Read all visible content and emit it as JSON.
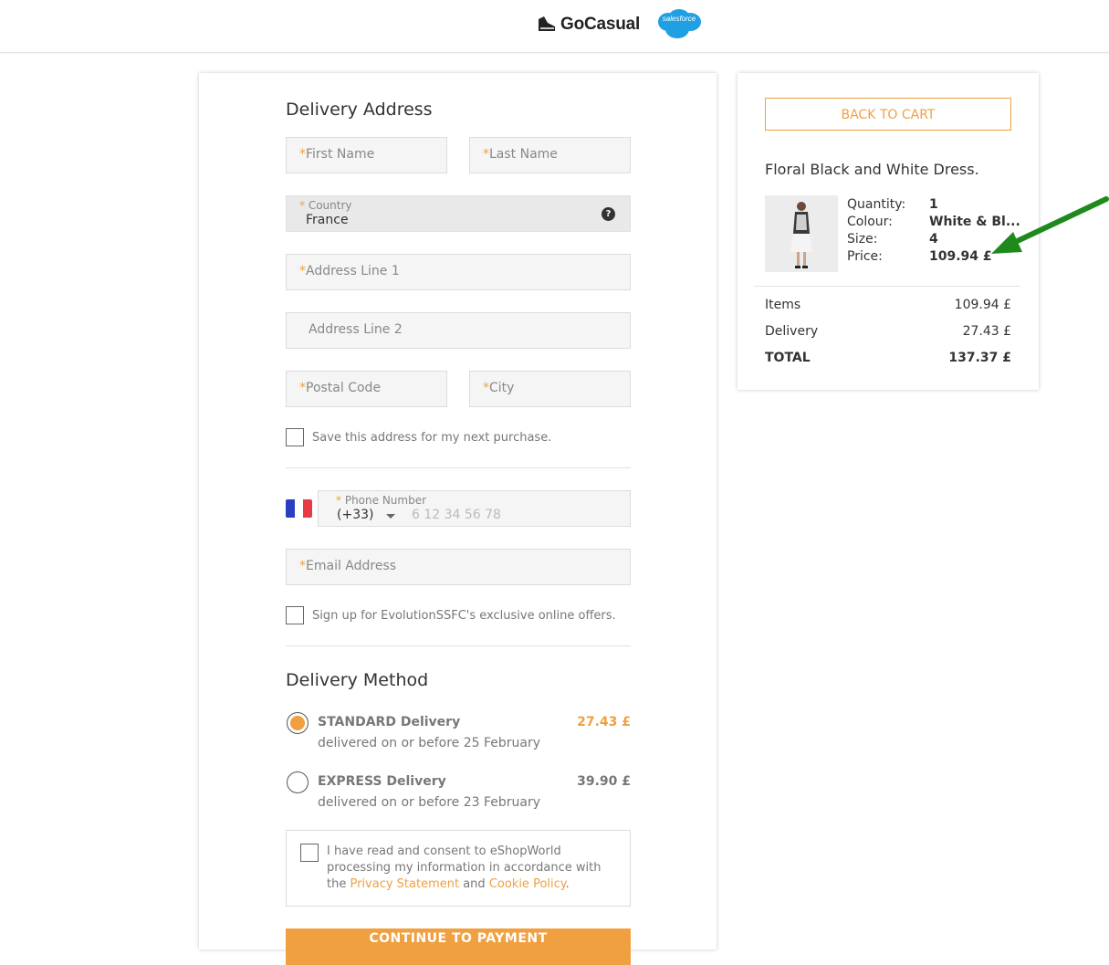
{
  "header": {
    "brand_name": "GoCasual",
    "partner_logo_text": "salesforce"
  },
  "delivery_address": {
    "title": "Delivery Address",
    "first_name_placeholder": "First Name",
    "last_name_placeholder": "Last Name",
    "country_label": "Country",
    "country_value": "France",
    "address_line1_placeholder": "Address Line 1",
    "address_line2_placeholder": "Address Line 2",
    "postal_code_placeholder": "Postal Code",
    "city_placeholder": "City",
    "save_address_label": "Save this address for my next purchase.",
    "phone_label": "Phone Number",
    "phone_prefix": "(+33)",
    "phone_placeholder": "6 12 34 56 78",
    "email_placeholder": "Email Address",
    "signup_label": "Sign up for EvolutionSSFC's exclusive online offers.",
    "required_mark": "*"
  },
  "delivery_method": {
    "title": "Delivery Method",
    "options": [
      {
        "name": "STANDARD Delivery",
        "detail": "delivered on or before 25 February",
        "price": "27.43 £",
        "selected": true
      },
      {
        "name": "EXPRESS Delivery",
        "detail": "delivered on or before 23 February",
        "price": "39.90 £",
        "selected": false
      }
    ]
  },
  "consent": {
    "text_before": "I have read and consent to eShopWorld processing my information in accordance with the ",
    "privacy_link": "Privacy Statement",
    "and_text": " and ",
    "cookie_link": "Cookie Policy",
    "end_text": "."
  },
  "continue_button": "CONTINUE TO PAYMENT",
  "summary": {
    "back_button": "BACK TO CART",
    "product_name": "Floral Black and White Dress.",
    "attributes": [
      {
        "label": "Quantity:",
        "value": "1"
      },
      {
        "label": "Colour:",
        "value": "White & Bl..."
      },
      {
        "label": "Size:",
        "value": "4"
      },
      {
        "label": "Price:",
        "value": "109.94 £"
      }
    ],
    "items_label": "Items",
    "items_value": "109.94 £",
    "delivery_label": "Delivery",
    "delivery_value": "27.43 £",
    "total_label": "TOTAL",
    "total_value": "137.37 £"
  },
  "colors": {
    "accent": "#f0a040",
    "annotation_arrow": "#1e8a1e"
  }
}
